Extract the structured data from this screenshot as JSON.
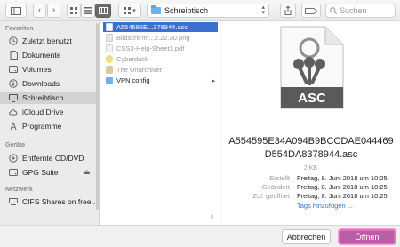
{
  "toolbar": {
    "path_label": "Schreibtisch",
    "search_placeholder": "Suchen"
  },
  "sidebar": {
    "favorites_heading": "Favoriten",
    "favorites": [
      {
        "label": "Zuletzt benutzt",
        "icon": "clock-icon"
      },
      {
        "label": "Dokumente",
        "icon": "documents-icon"
      },
      {
        "label": "Volumes",
        "icon": "drive-icon"
      },
      {
        "label": "Downloads",
        "icon": "download-icon"
      },
      {
        "label": "Schreibtisch",
        "icon": "desktop-icon",
        "selected": true
      },
      {
        "label": "iCloud Drive",
        "icon": "cloud-icon"
      },
      {
        "label": "Programme",
        "icon": "applications-icon"
      }
    ],
    "devices_heading": "Geräte",
    "devices": [
      {
        "label": "Entfernte CD/DVD",
        "icon": "disc-icon"
      },
      {
        "label": "GPG Suite",
        "icon": "drive-icon"
      }
    ],
    "network_heading": "Netzwerk",
    "network": [
      {
        "label": "CIFS Shares on free...",
        "icon": "network-icon"
      }
    ]
  },
  "files": [
    {
      "name": "A554595E...378944.asc",
      "selected": true,
      "enabled": true
    },
    {
      "name": "Bildschirmf...2.22.30.png",
      "enabled": false
    },
    {
      "name": "CSS3-Help-Sheet1.pdf",
      "enabled": false
    },
    {
      "name": "Cyberduck",
      "enabled": false
    },
    {
      "name": "The Unarchiver",
      "enabled": false
    },
    {
      "name": "VPN config",
      "enabled": true,
      "folder": true
    }
  ],
  "preview": {
    "icon_label": "ASC",
    "filename": "A554595E34A094B9BCCDAE044469D554DA8378944.asc",
    "size": "2 KB",
    "created_label": "Erstellt",
    "created_value": "Freitag, 8. Juni 2018 um 10:25",
    "modified_label": "Geändert",
    "modified_value": "Freitag, 8. Juni 2018 um 10:25",
    "opened_label": "Zul. geöffnet",
    "opened_value": "Freitag, 8. Juni 2018 um 10:25",
    "tags_link": "Tags hinzufügen ..."
  },
  "buttons": {
    "cancel": "Abbrechen",
    "open": "Öffnen"
  },
  "colors": {
    "selection": "#3d6fd0",
    "open_button": "#b85ea2",
    "folder": "#6ab2f0"
  }
}
